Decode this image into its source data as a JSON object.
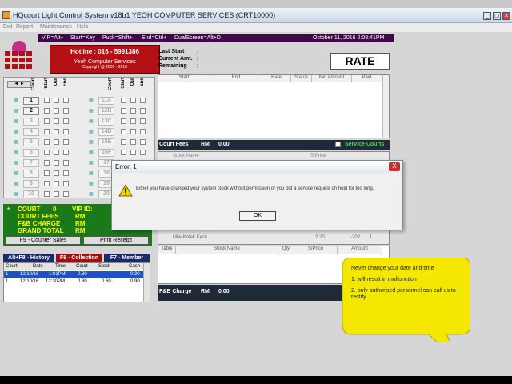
{
  "window": {
    "title": "HQcourt Light Control System v18b1 YEOH COMPUTER SERVICES (CRT10000)",
    "menu": [
      "Exit",
      "Report",
      "Maintenance",
      "Help"
    ]
  },
  "shortcuts": [
    "VIP=Alt+",
    "Start=Key",
    "Puck=Shift+",
    "End=Ctrl+",
    "DualScreen=Alt+D"
  ],
  "datetime": "October 11, 2016  2:08:41PM",
  "hotline": {
    "line1": "Hotline : 016 - 5991386",
    "line2": "Yeoh Computer Services",
    "line3": "Copyright @ 2009 - 2016"
  },
  "grid": {
    "headers": [
      "Court",
      "Start",
      "Out",
      "End"
    ],
    "left_courts": [
      "1",
      "2",
      "3",
      "4",
      "5",
      "6",
      "7",
      "8",
      "9",
      "10"
    ],
    "right_courts": [
      "11A",
      "12B",
      "13C",
      "14D",
      "15E",
      "16F",
      "17",
      "18",
      "19",
      "20"
    ]
  },
  "info": {
    "star": "*",
    "court_label": "COURT",
    "court_value": "0",
    "vip_label": "VIP ID:",
    "fees_label": "COURT FEES",
    "fees_unit": "RM",
    "fnb_label": "F&B CHARGE",
    "fnb_unit": "RM",
    "total_label": "GRAND TOTAL",
    "total_unit": "RM",
    "counter_sales": "F9 - Counter Sales",
    "print_receipt": "Print Receipt"
  },
  "history_tabs": [
    "Alt+F8 - History",
    "F8 - Collection",
    "F7 - Member"
  ],
  "history": {
    "headers": [
      "Court",
      "Date",
      "Time",
      "Court",
      "Stock",
      "Cash"
    ],
    "rows": [
      [
        "1",
        "12/10/16",
        "1:01PM",
        "0.30",
        "",
        "0.30"
      ],
      [
        "1",
        "12/10/16",
        "12:30PM",
        "0.30",
        "0.60",
        "0.90"
      ]
    ]
  },
  "session": {
    "last_start": "Last Start",
    "current_amt": "Current Amt.",
    "remaining": "Remaining",
    "colon": ":",
    "rate_button": "RATE",
    "table_headers": [
      "Start",
      "End",
      "Rate",
      "Status",
      "Net Amount",
      "Paid"
    ],
    "court_fees_label": "Court Fees",
    "court_fees_unit": "RM",
    "court_fees_value": "0.00",
    "service_courts": "Service Courts"
  },
  "middle_panel": {
    "header_left": "Stock Name",
    "header_price": "S/Price",
    "row_item": "Mile Kotak Kecil",
    "row_price": "2.20",
    "row_amt": "-20?",
    "row_qty": "1"
  },
  "fnb": {
    "headers": [
      "Table",
      "Stock Name",
      "Qty",
      "S/Price",
      "Amount"
    ],
    "charge_label": "F&B Charge",
    "charge_unit": "RM",
    "charge_value": "0.00"
  },
  "dialog": {
    "title": "Error: 1",
    "close": "X",
    "message": "Either you have changed your system clock without permission or you put a service request on hold for too long.",
    "ok": "OK"
  },
  "callout": {
    "line1": "Never change your date and time",
    "line2": "1. will result in mulfunction",
    "line3": "2. only authorised personnel can call us to rectify"
  },
  "colors": {
    "shortcut_bar": "#400848",
    "hotline": "#b51016",
    "info_panel": "#1a7a1a",
    "callout": "#f5e800"
  }
}
